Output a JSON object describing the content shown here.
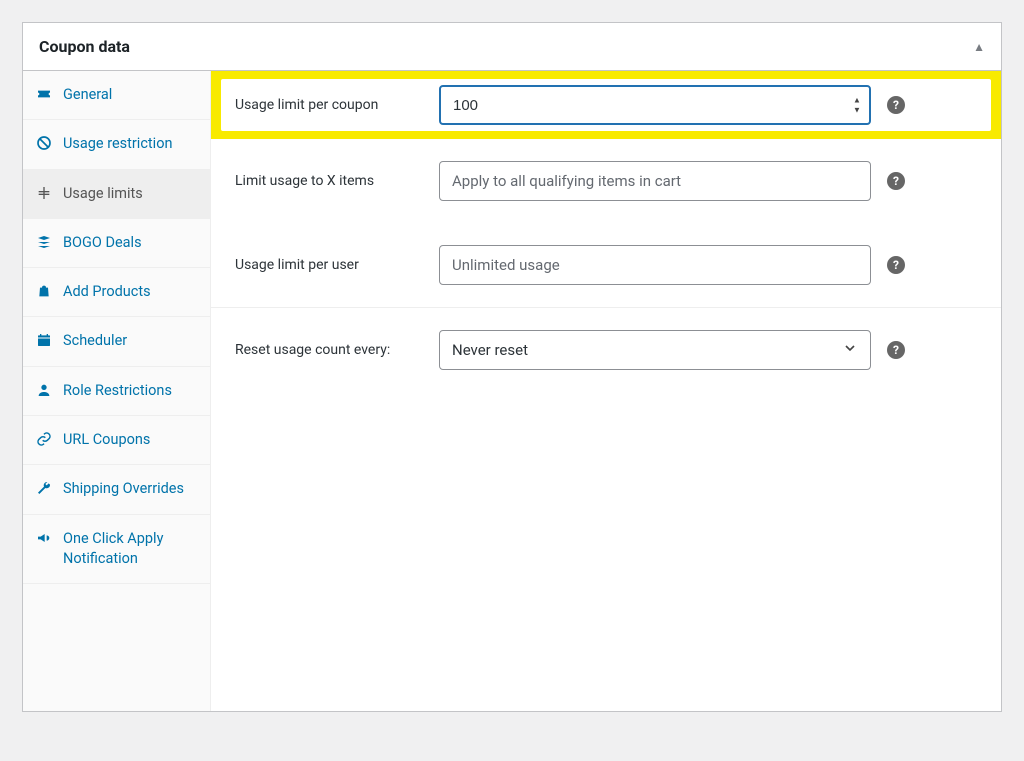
{
  "panel": {
    "title": "Coupon data"
  },
  "sidebar": {
    "items": [
      {
        "label": "General",
        "active": false
      },
      {
        "label": "Usage restriction",
        "active": false
      },
      {
        "label": "Usage limits",
        "active": true
      },
      {
        "label": "BOGO Deals",
        "active": false
      },
      {
        "label": "Add Products",
        "active": false
      },
      {
        "label": "Scheduler",
        "active": false
      },
      {
        "label": "Role Restrictions",
        "active": false
      },
      {
        "label": "URL Coupons",
        "active": false
      },
      {
        "label": "Shipping Overrides",
        "active": false
      },
      {
        "label": "One Click Apply Notification",
        "active": false
      }
    ]
  },
  "form": {
    "usage_limit_per_coupon": {
      "label": "Usage limit per coupon",
      "value": "100"
    },
    "limit_usage_to_x_items": {
      "label": "Limit usage to X items",
      "placeholder": "Apply to all qualifying items in cart"
    },
    "usage_limit_per_user": {
      "label": "Usage limit per user",
      "placeholder": "Unlimited usage"
    },
    "reset_usage_count": {
      "label": "Reset usage count every:",
      "value": "Never reset"
    }
  }
}
